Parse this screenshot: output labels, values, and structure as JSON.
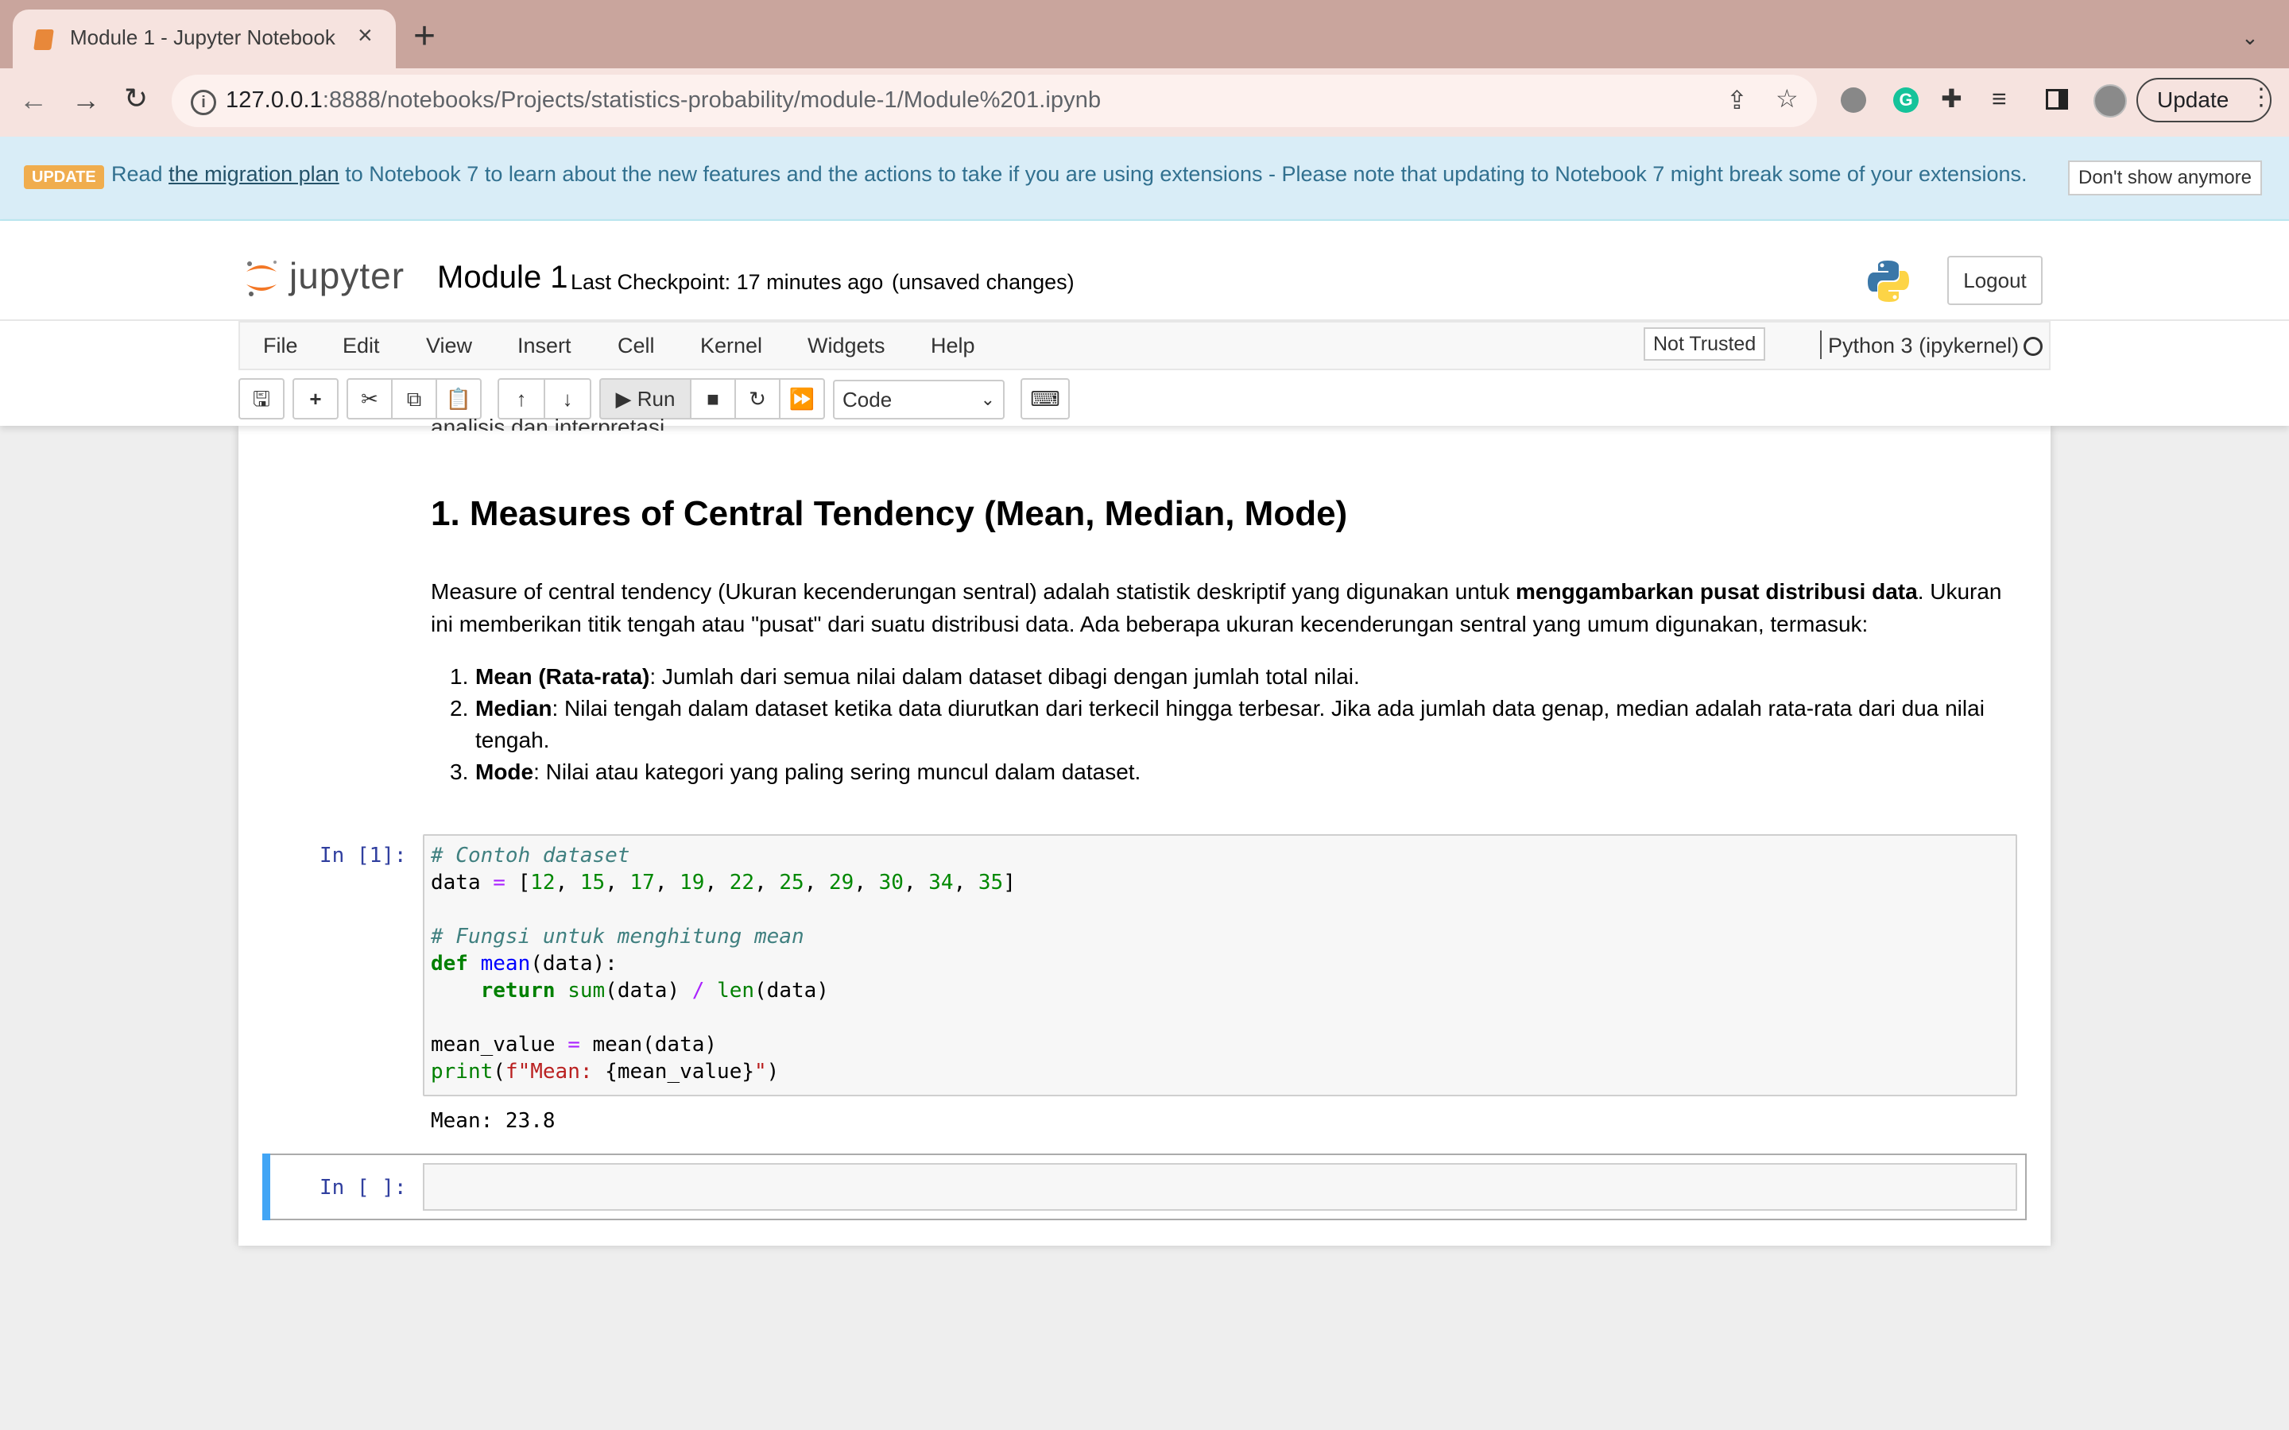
{
  "browser": {
    "tab_title": "Module 1 - Jupyter Notebook",
    "url_host": "127.0.0.1",
    "url_rest": ":8888/notebooks/Projects/statistics-probability/module-1/Module%201.ipynb",
    "update_label": "Update"
  },
  "banner": {
    "badge": "UPDATE",
    "text_pre": "Read ",
    "link": "the migration plan",
    "text_post": " to Notebook 7 to learn about the new features and the actions to take if you are using extensions - Please note that updating to Notebook 7 might break some of your extensions.",
    "dismiss": "Don't show anymore"
  },
  "header": {
    "logo_text": "jupyter",
    "notebook_name": "Module 1",
    "checkpoint": "Last Checkpoint: 17 minutes ago",
    "unsaved": "(unsaved changes)",
    "logout": "Logout"
  },
  "menu": {
    "items": [
      "File",
      "Edit",
      "View",
      "Insert",
      "Cell",
      "Kernel",
      "Widgets",
      "Help"
    ],
    "trust": "Not Trusted",
    "kernel": "Python 3 (ipykernel)"
  },
  "toolbar": {
    "run": "Run",
    "cell_type": "Code"
  },
  "notebook": {
    "clipped_line": "analisis dan interpretasi.",
    "heading": "1. Measures of Central Tendency (Mean, Median, Mode)",
    "para_pre": "Measure of central tendency (Ukuran kecenderungan sentral) adalah statistik deskriptif yang digunakan untuk ",
    "para_bold": "menggambarkan pusat distribusi data",
    "para_post": ". Ukuran ini memberikan titik tengah atau \"pusat\" dari suatu distribusi data. Ada beberapa ukuran kecenderungan sentral yang umum digunakan, termasuk:",
    "list": [
      {
        "num": "1.",
        "term": "Mean (Rata-rata)",
        "desc": ": Jumlah dari semua nilai dalam dataset dibagi dengan jumlah total nilai."
      },
      {
        "num": "2.",
        "term": "Median",
        "desc": ": Nilai tengah dalam dataset ketika data diurutkan dari terkecil hingga terbesar. Jika ada jumlah data genap, median adalah rata-rata dari dua nilai tengah."
      },
      {
        "num": "3.",
        "term": "Mode",
        "desc": ": Nilai atau kategori yang paling sering muncul dalam dataset."
      }
    ],
    "cell1_prompt": "In [1]:",
    "cell1_output": "Mean: 23.8",
    "cell2_prompt": "In [ ]:"
  }
}
